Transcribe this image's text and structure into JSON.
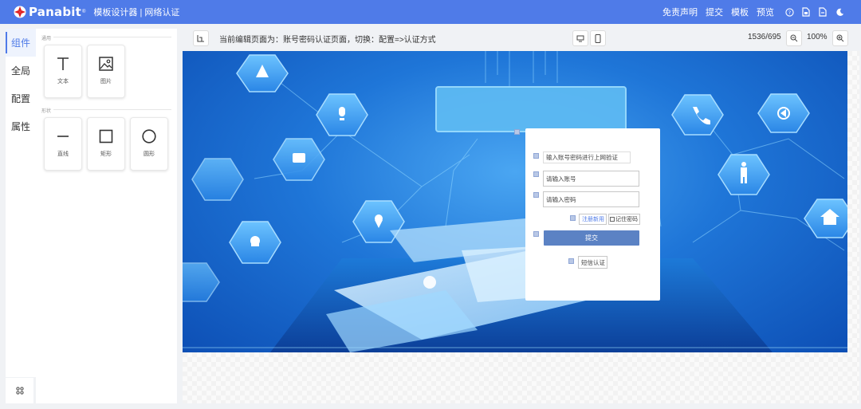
{
  "header": {
    "brand": "Panabit",
    "title": "模板设计器 | 网络认证",
    "links": [
      "免责声明",
      "提交",
      "模板",
      "预览"
    ],
    "accent": "#4f7be8"
  },
  "left_tabs": [
    "组件",
    "全局",
    "配置",
    "属性"
  ],
  "panel": {
    "group_general": "通用",
    "group_shapes": "形状",
    "items_general": [
      {
        "label": "文本",
        "icon": "text-icon"
      },
      {
        "label": "图片",
        "icon": "image-icon"
      }
    ],
    "items_shapes": [
      {
        "label": "直线",
        "icon": "line-icon"
      },
      {
        "label": "矩形",
        "icon": "rect-icon"
      },
      {
        "label": "圆形",
        "icon": "circle-icon"
      }
    ]
  },
  "toolbar": {
    "status": "当前编辑页面为：账号密码认证页面，切换：配置=>认证方式",
    "size": "1536/695",
    "zoom": "100%"
  },
  "login": {
    "title": "输入账号密码进行上网验证",
    "username_placeholder": "请输入账号",
    "password_placeholder": "请输入密码",
    "register": "注册新用",
    "remember": "记住密码",
    "submit": "提交",
    "sms": "短信认证"
  }
}
